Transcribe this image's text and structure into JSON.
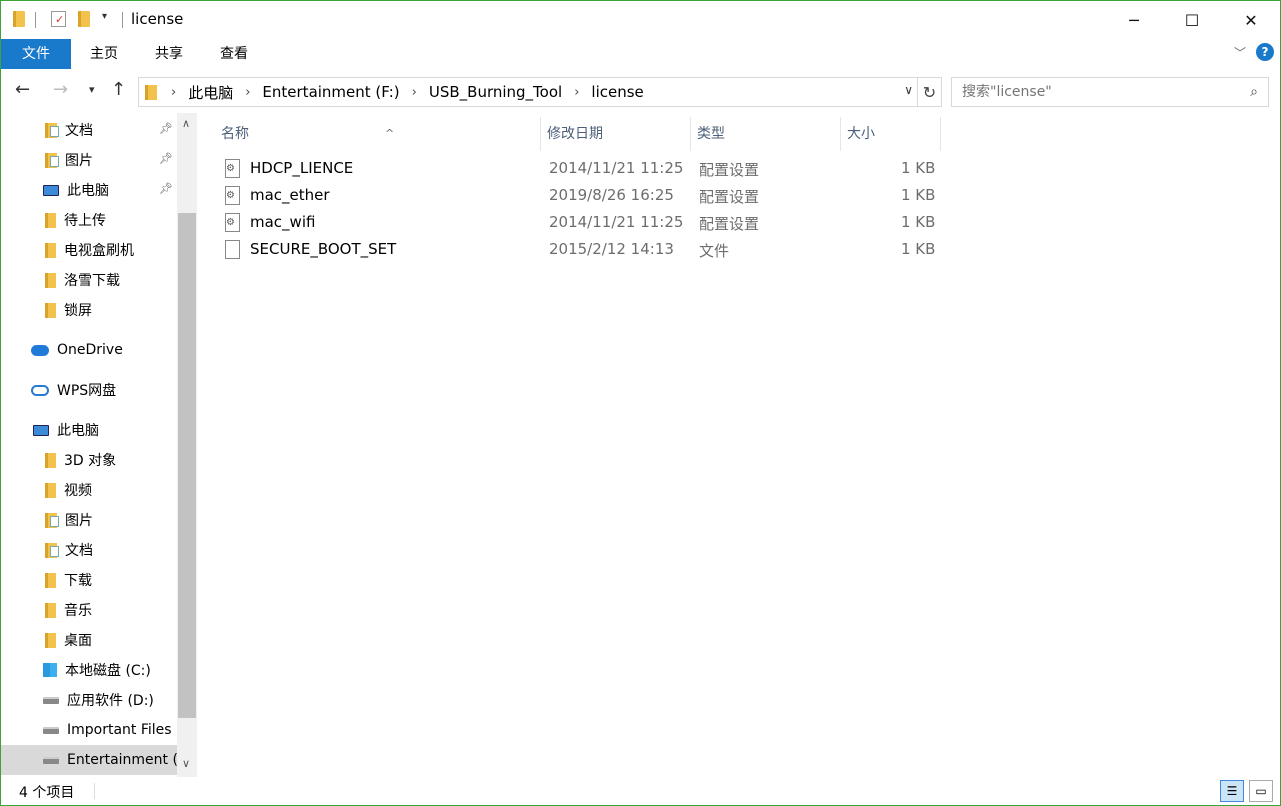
{
  "window": {
    "title": "license"
  },
  "ribbon": {
    "tabs": [
      "文件",
      "主页",
      "共享",
      "查看"
    ]
  },
  "address": {
    "crumbs": [
      "此电脑",
      "Entertainment (F:)",
      "USB_Burning_Tool",
      "license"
    ]
  },
  "search": {
    "placeholder": "搜索\"license\""
  },
  "nav": {
    "items": [
      {
        "label": "文档",
        "icon": "documents-icon",
        "pinned": true
      },
      {
        "label": "图片",
        "icon": "pictures-icon",
        "pinned": true
      },
      {
        "label": "此电脑",
        "icon": "computer-icon",
        "pinned": true
      },
      {
        "label": "待上传",
        "icon": "folder-icon"
      },
      {
        "label": "电视盒刷机",
        "icon": "folder-icon"
      },
      {
        "label": "洛雪下载",
        "icon": "folder-icon"
      },
      {
        "label": "锁屏",
        "icon": "folder-icon"
      },
      {
        "label": "OneDrive",
        "icon": "onedrive-icon"
      },
      {
        "label": "WPS网盘",
        "icon": "cloud-icon"
      },
      {
        "label": "此电脑",
        "icon": "computer-icon"
      },
      {
        "label": "3D 对象",
        "icon": "3d-objects-icon"
      },
      {
        "label": "视频",
        "icon": "videos-icon"
      },
      {
        "label": "图片",
        "icon": "pictures-icon"
      },
      {
        "label": "文档",
        "icon": "documents-icon"
      },
      {
        "label": "下载",
        "icon": "downloads-icon"
      },
      {
        "label": "音乐",
        "icon": "music-icon"
      },
      {
        "label": "桌面",
        "icon": "desktop-icon"
      },
      {
        "label": "本地磁盘 (C:)",
        "icon": "windows-drive-icon"
      },
      {
        "label": "应用软件 (D:)",
        "icon": "drive-icon"
      },
      {
        "label": "Important Files",
        "icon": "drive-icon"
      },
      {
        "label": "Entertainment (",
        "icon": "drive-icon",
        "selected": true
      }
    ]
  },
  "columns": {
    "name": "名称",
    "modified": "修改日期",
    "type": "类型",
    "size": "大小"
  },
  "files": [
    {
      "name": "HDCP_LIENCE",
      "modified": "2014/11/21 11:25",
      "type": "配置设置",
      "size": "1 KB",
      "icon": "config-file-icon"
    },
    {
      "name": "mac_ether",
      "modified": "2019/8/26 16:25",
      "type": "配置设置",
      "size": "1 KB",
      "icon": "config-file-icon"
    },
    {
      "name": "mac_wifi",
      "modified": "2014/11/21 11:25",
      "type": "配置设置",
      "size": "1 KB",
      "icon": "config-file-icon"
    },
    {
      "name": "SECURE_BOOT_SET",
      "modified": "2015/2/12 14:13",
      "type": "文件",
      "size": "1 KB",
      "icon": "file-icon"
    }
  ],
  "status": {
    "item_count": "4 个项目"
  },
  "colors": {
    "accent": "#1979ca",
    "window_border": "#3aa33a",
    "selection": "#d9d9d9",
    "header_text": "#4c607a"
  }
}
